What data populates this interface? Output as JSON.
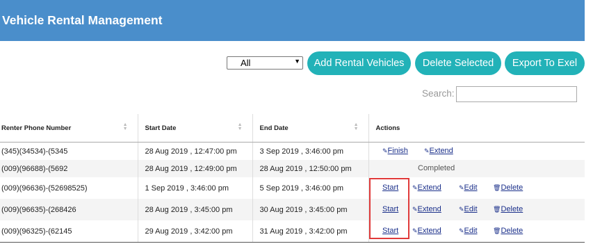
{
  "header": {
    "title": "Vehicle Rental Management"
  },
  "toolbar": {
    "filter_value": "All",
    "add_label": "Add Rental Vehicles",
    "delete_label": "Delete Selected",
    "export_label": "Export To Exel"
  },
  "search": {
    "label": "Search:",
    "value": ""
  },
  "table": {
    "columns": [
      "Renter Phone Number",
      "Start Date",
      "End Date",
      "Actions"
    ],
    "rows": [
      {
        "phone": "(345)(34534)-(5345",
        "start": "28 Aug 2019 , 12:47:00 pm",
        "end": "3 Sep 2019 , 3:46:00 pm",
        "actions": [
          "Finish",
          "Extend"
        ]
      },
      {
        "phone": "(009)(96688)-(5692",
        "start": "28 Aug 2019 , 12:49:00 pm",
        "end": "28 Aug 2019 , 12:50:00 pm",
        "status": "Completed"
      },
      {
        "phone": "(009)(96636)-(52698525)",
        "start": "1 Sep 2019 , 3:46:00 pm",
        "end": "5 Sep 2019 , 3:46:00 pm",
        "actions": [
          "Start",
          "Extend",
          "Edit",
          "Delete"
        ]
      },
      {
        "phone": "(009)(96635)-(268426",
        "start": "28 Aug 2019 , 3:45:00 pm",
        "end": "30 Aug 2019 , 3:45:00 pm",
        "actions": [
          "Start",
          "Extend",
          "Edit",
          "Delete"
        ]
      },
      {
        "phone": "(009)(96325)-(62145",
        "start": "29 Aug 2019 , 3:42:00 pm",
        "end": "31 Aug 2019 , 3:42:00 pm",
        "actions": [
          "Start",
          "Extend",
          "Edit",
          "Delete"
        ]
      }
    ]
  },
  "colors": {
    "header": "#4a8ecb",
    "button": "#22b2b8",
    "link": "#1a2f8a",
    "highlight": "#e03a3a"
  }
}
